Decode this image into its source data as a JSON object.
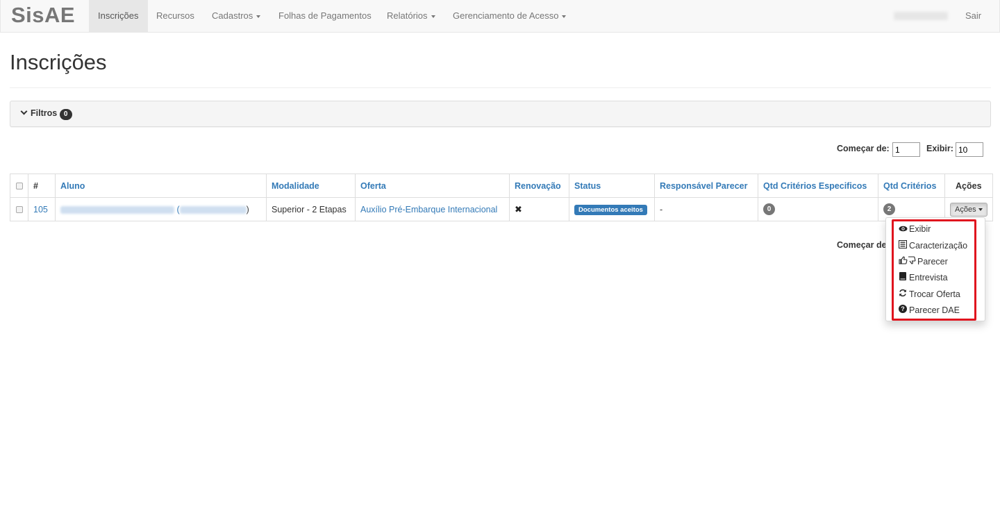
{
  "navbar": {
    "brand": "SisAE",
    "items": [
      {
        "label": "Inscrições",
        "active": true,
        "dropdown": false
      },
      {
        "label": "Recursos",
        "active": false,
        "dropdown": false
      },
      {
        "label": "Cadastros",
        "active": false,
        "dropdown": true
      },
      {
        "label": "Folhas de Pagamentos",
        "active": false,
        "dropdown": false
      },
      {
        "label": "Relatórios",
        "active": false,
        "dropdown": true
      },
      {
        "label": "Gerenciamento de Acesso",
        "active": false,
        "dropdown": true
      }
    ],
    "logout": "Sair"
  },
  "page": {
    "title": "Inscrições"
  },
  "filters": {
    "label": "Filtros",
    "count": "0",
    "icon": "chevron-down-icon"
  },
  "pagination": {
    "start_label": "Começar de:",
    "start_value": "1",
    "show_label": "Exibir:",
    "show_value": "10",
    "bottom_start_label": "Começar de"
  },
  "table": {
    "headers": {
      "number": "#",
      "aluno": "Aluno",
      "modalidade": "Modalidade",
      "oferta": "Oferta",
      "renovacao": "Renovação",
      "status": "Status",
      "responsavel": "Responsável Parecer",
      "qtd_especificos": "Qtd Critérios Especificos",
      "qtd_criterios": "Qtd Critérios",
      "acoes": "Ações"
    },
    "rows": [
      {
        "id": "105",
        "aluno_paren_open": "(",
        "aluno_paren_close": ")",
        "modalidade": "Superior - 2 Etapas",
        "oferta": "Auxílio Pré-Embarque Internacional",
        "renovacao_icon": "times-icon",
        "renovacao_glyph": "✖",
        "status": "Documentos aceitos",
        "responsavel": "-",
        "qtd_especificos": "0",
        "qtd_criterios": "2",
        "acoes_button": "Ações"
      }
    ]
  },
  "actions_menu": {
    "items": [
      {
        "label": "Exibir",
        "icon": "eye-icon"
      },
      {
        "label": "Caracterização",
        "icon": "list-alt-icon"
      },
      {
        "label": "Parecer",
        "icon": "thumbs-up-down-icon"
      },
      {
        "label": "Entrevista",
        "icon": "book-icon"
      },
      {
        "label": "Trocar Oferta",
        "icon": "refresh-icon"
      },
      {
        "label": "Parecer DAE",
        "icon": "question-sign-icon"
      }
    ],
    "highlight_color": "#e0141e"
  },
  "colors": {
    "link": "#337ab7",
    "navbar_bg": "#f8f8f8",
    "active_nav_bg": "#e7e7e7"
  }
}
